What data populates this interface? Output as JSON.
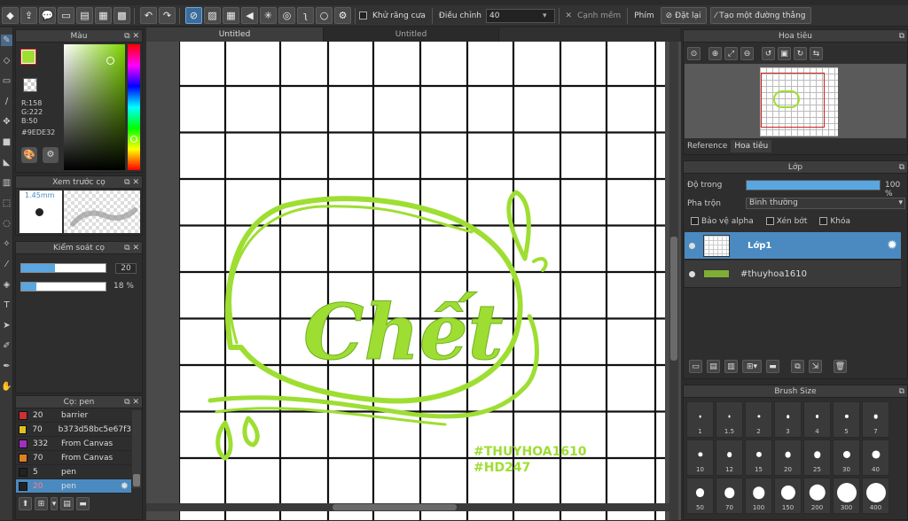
{
  "toolbar": {
    "antialias_label": "Khử răng cưa",
    "adjust_label": "Điều chỉnh",
    "adjust_value": "40",
    "soft_edge_label": "Cạnh mềm",
    "shortcut_label": "Phím",
    "reset_label": "Đặt lại",
    "line_label": "Tạo một đường thẳng"
  },
  "tabs": [
    "Untitled",
    "Untitled"
  ],
  "color_panel": {
    "title": "Màu",
    "r": "R:158",
    "g": "G:222",
    "b": "B:50",
    "hex": "#9EDE32",
    "current_color": "#9EDE32"
  },
  "brush_preview": {
    "title": "Xem trước cọ",
    "size": "1.45mm"
  },
  "brush_control": {
    "title": "Kiểm soát cọ",
    "size_value": "20",
    "size_fraction": 0.4,
    "opacity_value": "18 %",
    "opacity_fraction": 0.18
  },
  "brush_list": {
    "title": "Cọ: pen",
    "items": [
      {
        "num": "20",
        "name": "barrier",
        "color": "#d03030"
      },
      {
        "num": "70",
        "name": "b373d58bc5e67f3",
        "color": "#e0c020"
      },
      {
        "num": "332",
        "name": "From Canvas",
        "color": "#a030c0"
      },
      {
        "num": "70",
        "name": "From Canvas",
        "color": "#e08020"
      },
      {
        "num": "5",
        "name": "pen",
        "color": "#222222"
      },
      {
        "num": "20",
        "name": "pen",
        "color": "#222222"
      }
    ]
  },
  "navigator": {
    "title": "Hoa tiêu",
    "tab_reference": "Reference",
    "tab_navigator": "Hoa tiêu"
  },
  "layers_panel": {
    "title": "Lớp",
    "opacity_label": "Độ trong",
    "opacity_value": "100 %",
    "opacity_fraction": 1.0,
    "blend_label": "Pha trộn",
    "blend_value": "Bình thường",
    "protect_alpha": "Bảo vệ alpha",
    "clipping": "Xén bớt",
    "lock": "Khóa",
    "layers": [
      {
        "name": "Lớp1"
      },
      {
        "name": "#thuyhoa1610"
      }
    ]
  },
  "brush_size": {
    "title": "Brush Size",
    "sizes": [
      "1",
      "1.5",
      "2",
      "3",
      "4",
      "5",
      "7",
      "10",
      "12",
      "15",
      "20",
      "25",
      "30",
      "40",
      "50",
      "70",
      "100",
      "150",
      "200",
      "300",
      "400"
    ]
  },
  "artwork": {
    "word": "Chết",
    "hashtag1": "#THUYHOA1610",
    "hashtag2": "#HD247"
  }
}
